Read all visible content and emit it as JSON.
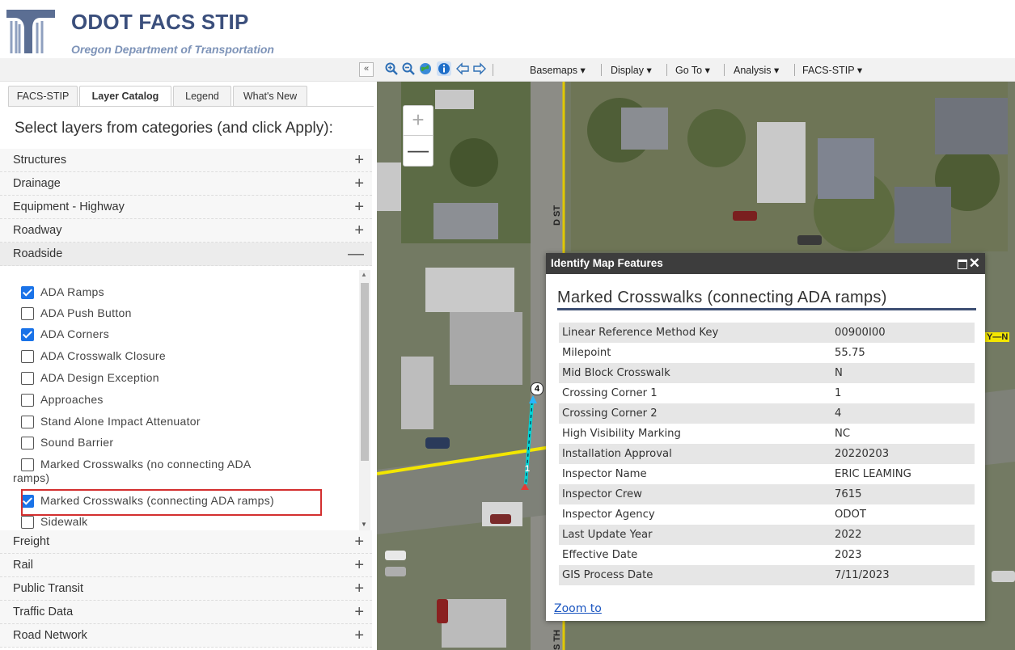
{
  "header": {
    "title": "ODOT FACS STIP",
    "subtitle": "Oregon Department of Transportation"
  },
  "panel": {
    "collapse_label": "«",
    "tabs": [
      {
        "label": "FACS-STIP",
        "active": false
      },
      {
        "label": "Layer Catalog",
        "active": true
      },
      {
        "label": "Legend",
        "active": false
      },
      {
        "label": "What's New",
        "active": false
      }
    ],
    "instruction": "Select layers from categories (and click Apply):",
    "categories_top": [
      {
        "label": "Structures",
        "sign": "+"
      },
      {
        "label": "Drainage",
        "sign": "+"
      },
      {
        "label": "Equipment - Highway",
        "sign": "+"
      },
      {
        "label": "Roadway",
        "sign": "+"
      },
      {
        "label": "Roadside",
        "sign": "—"
      }
    ],
    "roadside_layers": [
      {
        "label": "ADA Ramps",
        "checked": true
      },
      {
        "label": "ADA Push Button",
        "checked": false
      },
      {
        "label": "ADA Corners",
        "checked": true
      },
      {
        "label": "ADA Crosswalk Closure",
        "checked": false
      },
      {
        "label": "ADA Design Exception",
        "checked": false
      },
      {
        "label": "Approaches",
        "checked": false
      },
      {
        "label": "Stand Alone Impact Attenuator",
        "checked": false
      },
      {
        "label": "Sound Barrier",
        "checked": false
      },
      {
        "label": "Marked Crosswalks (no connecting ADA",
        "label2": "ramps)",
        "checked": false
      },
      {
        "label": "Marked Crosswalks (connecting ADA ramps)",
        "checked": true
      },
      {
        "label": "Sidewalk",
        "checked": false
      }
    ],
    "categories_bottom": [
      {
        "label": "Freight",
        "sign": "+"
      },
      {
        "label": "Rail",
        "sign": "+"
      },
      {
        "label": "Public Transit",
        "sign": "+"
      },
      {
        "label": "Traffic Data",
        "sign": "+"
      },
      {
        "label": "Road Network",
        "sign": "+"
      }
    ]
  },
  "toolbar": {
    "icons": [
      "zoom-in-icon",
      "zoom-out-icon",
      "globe-icon",
      "info-icon",
      "back-arrow-icon",
      "forward-arrow-icon"
    ],
    "menus": [
      "Basemaps ▾",
      "Display ▾",
      "Go To ▾",
      "Analysis ▾",
      "FACS-STIP ▾"
    ]
  },
  "map": {
    "zoom_in": "+",
    "zoom_out": "—",
    "road_labels": [
      "D ST",
      "Y—N",
      "S TH"
    ],
    "markers": [
      "4",
      "1"
    ]
  },
  "popup": {
    "title": "Identify Map Features",
    "feature_title": "Marked Crosswalks (connecting ADA ramps)",
    "attributes": [
      {
        "key": "Linear Reference Method Key",
        "value": "00900I00"
      },
      {
        "key": "Milepoint",
        "value": "55.75"
      },
      {
        "key": "Mid Block Crosswalk",
        "value": "N"
      },
      {
        "key": "Crossing Corner 1",
        "value": "1"
      },
      {
        "key": "Crossing Corner 2",
        "value": "4"
      },
      {
        "key": "High Visibility Marking",
        "value": "NC"
      },
      {
        "key": "Installation Approval",
        "value": "20220203"
      },
      {
        "key": "Inspector Name",
        "value": "ERIC LEAMING"
      },
      {
        "key": "Inspector Crew",
        "value": "7615"
      },
      {
        "key": "Inspector Agency",
        "value": "ODOT"
      },
      {
        "key": "Last Update Year",
        "value": "2022"
      },
      {
        "key": "Effective Date",
        "value": "2023"
      },
      {
        "key": "GIS Process Date",
        "value": "7/11/2023"
      }
    ],
    "zoom_link": "Zoom to"
  },
  "colors": {
    "header_title": "#3b4f7c",
    "checkbox_on": "#1a73e8",
    "highlight": "#d32f2f",
    "popup_bar": "#3d3d3d"
  }
}
